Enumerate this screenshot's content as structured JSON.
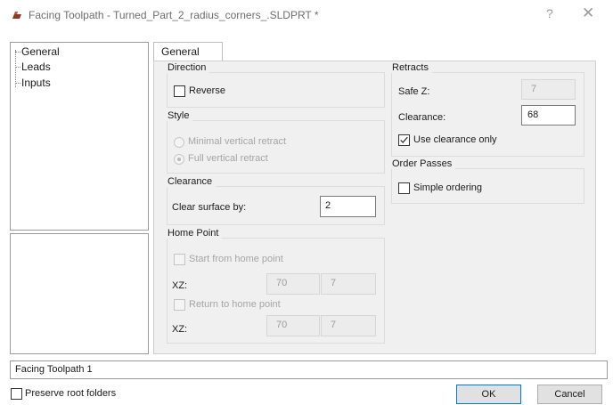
{
  "window": {
    "title": "Facing Toolpath - Turned_Part_2_radius_corners_.SLDPRT *",
    "help_icon": "?",
    "close_icon": "✕"
  },
  "tree": {
    "items": [
      "General",
      "Leads",
      "Inputs"
    ]
  },
  "tab": {
    "label": "General"
  },
  "direction": {
    "title": "Direction",
    "reverse_label": "Reverse",
    "reverse_checked": false
  },
  "style": {
    "title": "Style",
    "options": [
      "Minimal vertical retract",
      "Full vertical retract"
    ],
    "selected": "Full vertical retract"
  },
  "clearance_group": {
    "title": "Clearance",
    "clear_surface_label": "Clear surface by:",
    "clear_surface_value": "2"
  },
  "home_point": {
    "title": "Home Point",
    "start_label": "Start from home point",
    "start_xz_label": "XZ:",
    "start_x": "70",
    "start_z": "7",
    "return_label": "Return to home point",
    "return_xz_label": "XZ:",
    "return_x": "70",
    "return_z": "7"
  },
  "retracts": {
    "title": "Retracts",
    "safe_z_label": "Safe Z:",
    "safe_z_value": "7",
    "clearance_label": "Clearance:",
    "clearance_value": "68",
    "use_clearance_only_label": "Use clearance only",
    "use_clearance_only_checked": true
  },
  "order_passes": {
    "title": "Order Passes",
    "simple_ordering_label": "Simple ordering",
    "simple_ordering_checked": false
  },
  "toolpath_name": "Facing Toolpath 1",
  "footer": {
    "preserve_root_folders_label": "Preserve root folders",
    "ok_label": "OK",
    "cancel_label": "Cancel"
  }
}
